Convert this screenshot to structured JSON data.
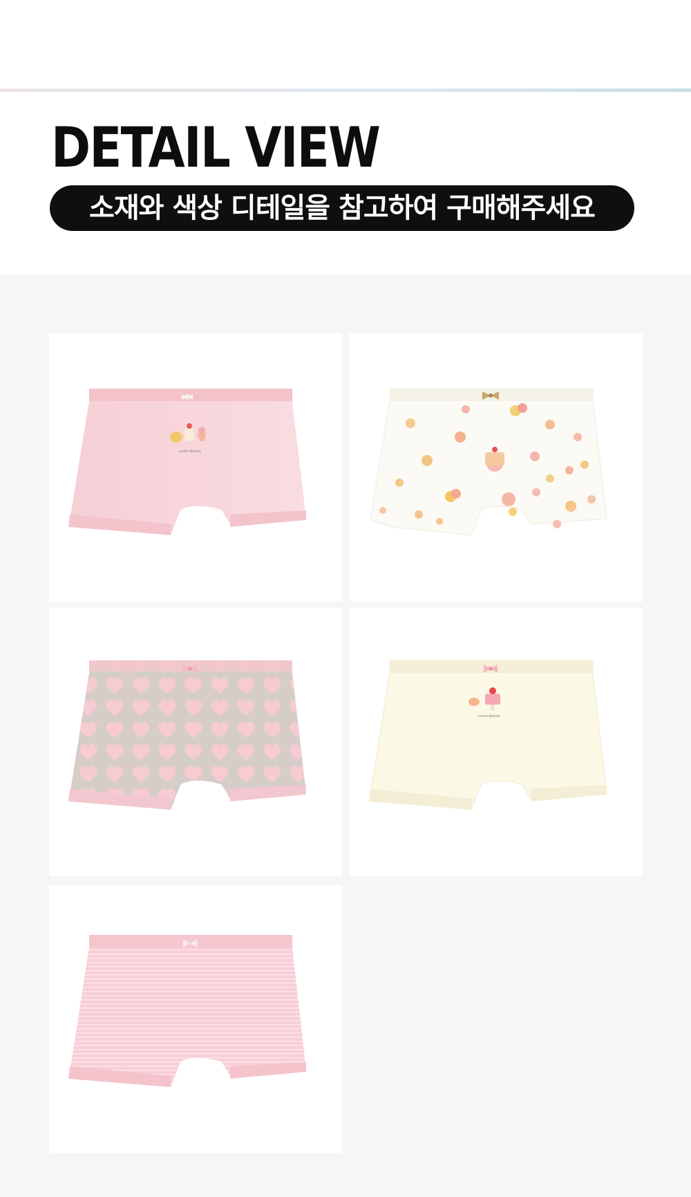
{
  "header": {
    "title": "DETAIL VIEW",
    "subtitle": "소재와 색상 디테일을 참고하여 구매해주세요"
  },
  "products": [
    {
      "id": "pink-solid",
      "pattern": "solid",
      "color": "#f8d6db",
      "trim": "#f7c9d0",
      "print": "sweet dessert",
      "motif": "dessert-icon"
    },
    {
      "id": "white-dessert",
      "pattern": "dessert-print",
      "color": "#fbfaf5",
      "trim": "#f4f1e7",
      "motif": "dessert-icon"
    },
    {
      "id": "heart-grey",
      "pattern": "hearts",
      "color": "#d9d0cb",
      "trim": "#f6cad1",
      "motif": "heart-icon"
    },
    {
      "id": "cream-solid",
      "pattern": "solid",
      "color": "#fbf8e6",
      "trim": "#f6f1d9",
      "print": "sweet dessert",
      "motif": "cake-icon"
    },
    {
      "id": "pink-stripe",
      "pattern": "stripes",
      "color": "#f7ced6",
      "trim": "#f5c3cc",
      "motif": "stripe"
    }
  ]
}
